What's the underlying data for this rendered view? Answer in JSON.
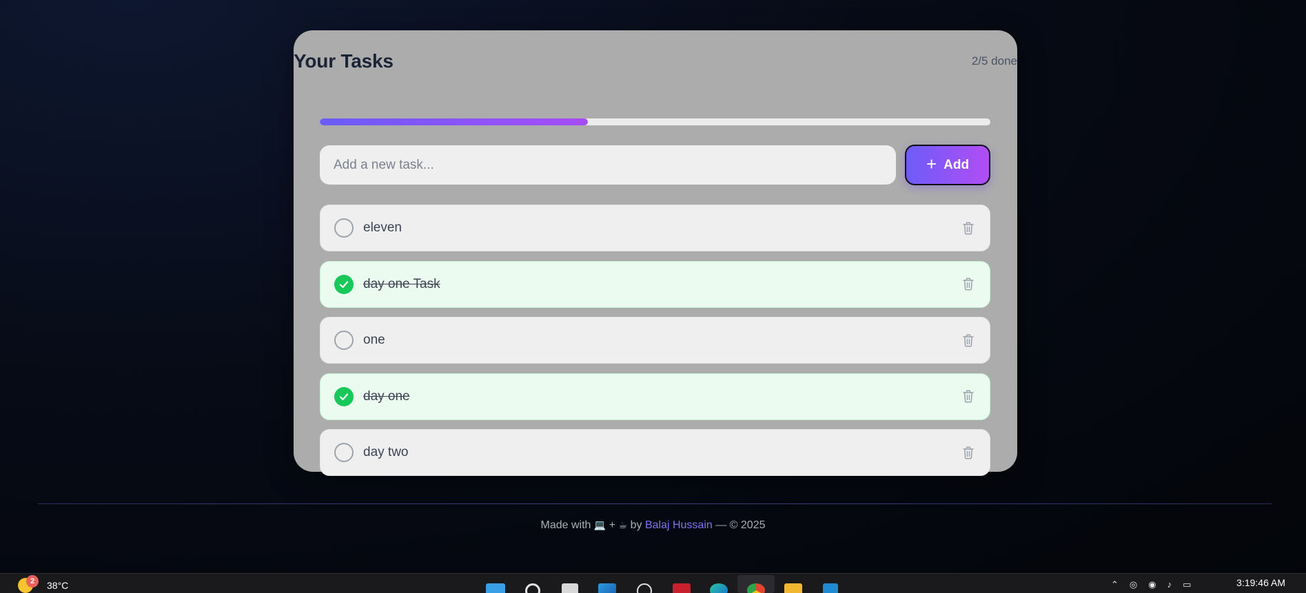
{
  "card": {
    "title": "Your Tasks",
    "counter": "2/5 done",
    "progress": 0.4
  },
  "add_form": {
    "placeholder": "Add a new task...",
    "value": "",
    "button_label": "Add",
    "button_icon": "plus-icon"
  },
  "tasks": [
    {
      "text": "eleven",
      "done": false
    },
    {
      "text": "day one Task",
      "done": true
    },
    {
      "text": "one",
      "done": false
    },
    {
      "text": "day one",
      "done": true
    },
    {
      "text": "day two",
      "done": false
    }
  ],
  "footer": {
    "made_with": "Made with",
    "emoji_laptop": "💻",
    "plus": "+",
    "emoji_coffee": "☕",
    "by": "by",
    "author": "Balaj Hussain",
    "copyright": "— © 2025"
  },
  "taskbar": {
    "weather_badge": "2",
    "temperature": "38°C",
    "clock": "3:19:46 AM",
    "apps": [
      "start-icon",
      "search-icon",
      "task-view-icon",
      "store-icon",
      "chatgpt-icon",
      "app-red-icon",
      "edge-icon",
      "chrome-icon",
      "file-explorer-icon",
      "vscode-icon"
    ]
  },
  "colors": {
    "accent_start": "#6d5cf7",
    "accent_end": "#b14df5",
    "done_check": "#18c95a",
    "done_row_bg": "#ecfbf0",
    "card_bg": "#acacac"
  }
}
